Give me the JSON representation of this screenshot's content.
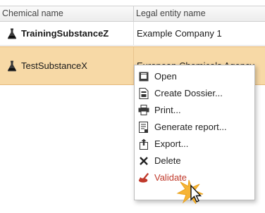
{
  "table": {
    "columns": [
      "Chemical name",
      "Legal entity name"
    ],
    "rows": [
      {
        "chemical_name": "TrainingSubstanceZ",
        "legal_entity": "Example Company 1",
        "selected": false
      },
      {
        "chemical_name": "TestSubstanceX",
        "legal_entity": "European Chemicals Agency",
        "selected": true
      }
    ],
    "selected_row_color": "#f7d9a6"
  },
  "context_menu": {
    "items": [
      {
        "label": "Open",
        "icon": "open-icon"
      },
      {
        "label": "Create Dossier...",
        "icon": "create-dossier-icon"
      },
      {
        "label": "Print...",
        "icon": "printer-icon"
      },
      {
        "label": "Generate report...",
        "icon": "report-icon"
      },
      {
        "label": "Export...",
        "icon": "export-icon"
      },
      {
        "label": "Delete",
        "icon": "delete-x-icon"
      },
      {
        "label": "Validate",
        "icon": "validate-checkmark-icon",
        "color": "#c0392b"
      }
    ]
  }
}
